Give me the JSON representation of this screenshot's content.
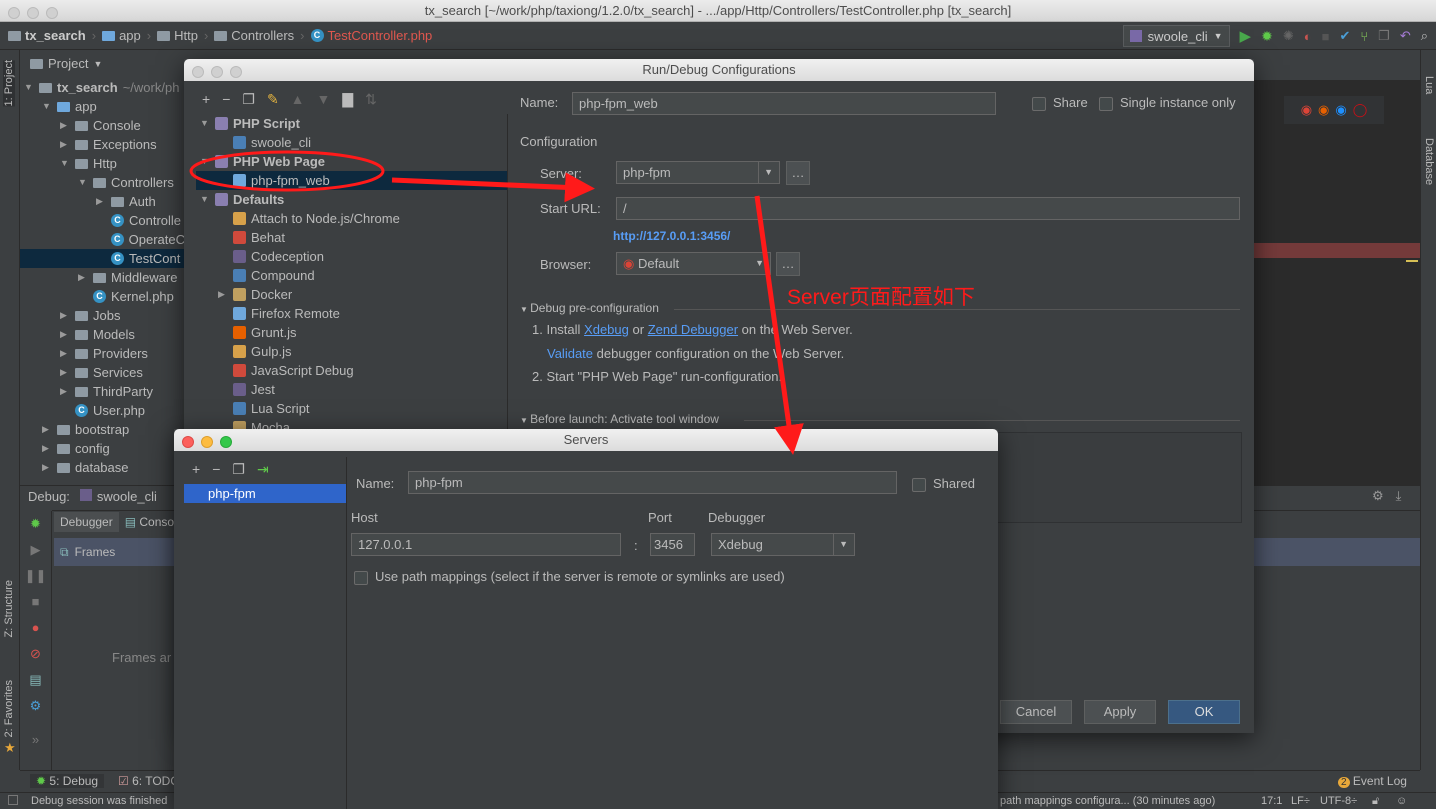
{
  "window_title": "tx_search [~/work/php/taxiong/1.2.0/tx_search] - .../app/Http/Controllers/TestController.php [tx_search]",
  "breadcrumb": [
    "tx_search",
    "app",
    "Http",
    "Controllers",
    "TestController.php"
  ],
  "run_config_combo": "swoole_cli",
  "left_strip": {
    "project": "1: Project",
    "structure": "Z: Structure",
    "favorites": "2: Favorites"
  },
  "right_strip": {
    "lua": "Lua",
    "database": "Database"
  },
  "project_panel": {
    "title": "Project",
    "tree": [
      {
        "label": "tx_search",
        "suffix": "~/work/ph",
        "depth": 0,
        "type": "folder",
        "open": true,
        "bold": true
      },
      {
        "label": "app",
        "depth": 1,
        "type": "folder-blue",
        "open": true
      },
      {
        "label": "Console",
        "depth": 2,
        "type": "folder",
        "open": false
      },
      {
        "label": "Exceptions",
        "depth": 2,
        "type": "folder",
        "open": false
      },
      {
        "label": "Http",
        "depth": 2,
        "type": "folder",
        "open": true
      },
      {
        "label": "Controllers",
        "depth": 3,
        "type": "folder",
        "open": true
      },
      {
        "label": "Auth",
        "depth": 4,
        "type": "folder",
        "open": false
      },
      {
        "label": "Controlle",
        "depth": 4,
        "type": "class"
      },
      {
        "label": "OperateC",
        "depth": 4,
        "type": "class"
      },
      {
        "label": "TestCont",
        "depth": 4,
        "type": "class",
        "selected": true
      },
      {
        "label": "Middleware",
        "depth": 3,
        "type": "folder",
        "open": false
      },
      {
        "label": "Kernel.php",
        "depth": 3,
        "type": "class"
      },
      {
        "label": "Jobs",
        "depth": 2,
        "type": "folder",
        "open": false
      },
      {
        "label": "Models",
        "depth": 2,
        "type": "folder",
        "open": false
      },
      {
        "label": "Providers",
        "depth": 2,
        "type": "folder",
        "open": false
      },
      {
        "label": "Services",
        "depth": 2,
        "type": "folder",
        "open": false
      },
      {
        "label": "ThirdParty",
        "depth": 2,
        "type": "folder",
        "open": false
      },
      {
        "label": "User.php",
        "depth": 2,
        "type": "class"
      },
      {
        "label": "bootstrap",
        "depth": 1,
        "type": "folder",
        "open": false
      },
      {
        "label": "config",
        "depth": 1,
        "type": "folder",
        "open": false
      },
      {
        "label": "database",
        "depth": 1,
        "type": "folder",
        "open": false
      }
    ]
  },
  "debug_panel": {
    "label": "Debug:",
    "session": "swoole_cli",
    "tabs": [
      "Debugger",
      "Consol"
    ],
    "frames_label": "Frames",
    "frames_empty": "Frames ar"
  },
  "bottom_tools": [
    {
      "label": "5: Debug"
    },
    {
      "label": "6: TODO"
    }
  ],
  "event_log": {
    "label": "Event Log",
    "count": "2"
  },
  "status_bar": {
    "left": "Debug session was finished",
    "middle": "path mappings configura... (30 minutes ago)",
    "position": "17:1",
    "line_sep": "LF÷",
    "encoding": "UTF-8÷"
  },
  "run_debug_dialog": {
    "title": "Run/Debug Configurations",
    "tree": [
      {
        "label": "PHP Script",
        "depth": 0,
        "group": true
      },
      {
        "label": "swoole_cli",
        "depth": 1
      },
      {
        "label": "PHP Web Page",
        "depth": 0,
        "group": true
      },
      {
        "label": "php-fpm_web",
        "depth": 1,
        "selected": true
      },
      {
        "label": "Defaults",
        "depth": 0,
        "group": true
      },
      {
        "label": "Attach to Node.js/Chrome",
        "depth": 1
      },
      {
        "label": "Behat",
        "depth": 1
      },
      {
        "label": "Codeception",
        "depth": 1
      },
      {
        "label": "Compound",
        "depth": 1
      },
      {
        "label": "Docker",
        "depth": 1,
        "collapsed": true
      },
      {
        "label": "Firefox Remote",
        "depth": 1
      },
      {
        "label": "Grunt.js",
        "depth": 1
      },
      {
        "label": "Gulp.js",
        "depth": 1
      },
      {
        "label": "JavaScript Debug",
        "depth": 1
      },
      {
        "label": "Jest",
        "depth": 1
      },
      {
        "label": "Lua Script",
        "depth": 1
      },
      {
        "label": "Mocha",
        "depth": 1
      }
    ],
    "name_label": "Name:",
    "name_value": "php-fpm_web",
    "share_label": "Share",
    "single_instance_label": "Single instance only",
    "configuration_label": "Configuration",
    "server_label": "Server:",
    "server_value": "php-fpm",
    "start_url_label": "Start URL:",
    "start_url_value": "/",
    "resolved_url": "http://127.0.0.1:3456/",
    "browser_label": "Browser:",
    "browser_value": "Default",
    "debug_preconfig_label": "Debug pre-configuration",
    "step1_prefix": "1. Install",
    "step1_xdebug": "Xdebug",
    "step1_or": "or",
    "step1_zend": "Zend Debugger",
    "step1_suffix": "on the Web Server.",
    "validate_link": "Validate",
    "validate_suffix": "debugger configuration on the Web Server.",
    "step2": "2. Start \"PHP Web Page\" run-configuration.",
    "before_launch_label": "Before launch: Activate tool window",
    "cancel": "Cancel",
    "apply": "Apply",
    "ok": "OK"
  },
  "servers_dialog": {
    "title": "Servers",
    "list": [
      "php-fpm"
    ],
    "name_label": "Name:",
    "name_value": "php-fpm",
    "shared_label": "Shared",
    "host_label": "Host",
    "host_value": "127.0.0.1",
    "port_label": "Port",
    "port_value": "3456",
    "debugger_label": "Debugger",
    "debugger_value": "Xdebug",
    "path_mappings_label": "Use path mappings (select if the server is remote or symlinks are used)"
  },
  "annotation": {
    "text": "Server页面配置如下",
    "color": "#ff1a1a"
  }
}
